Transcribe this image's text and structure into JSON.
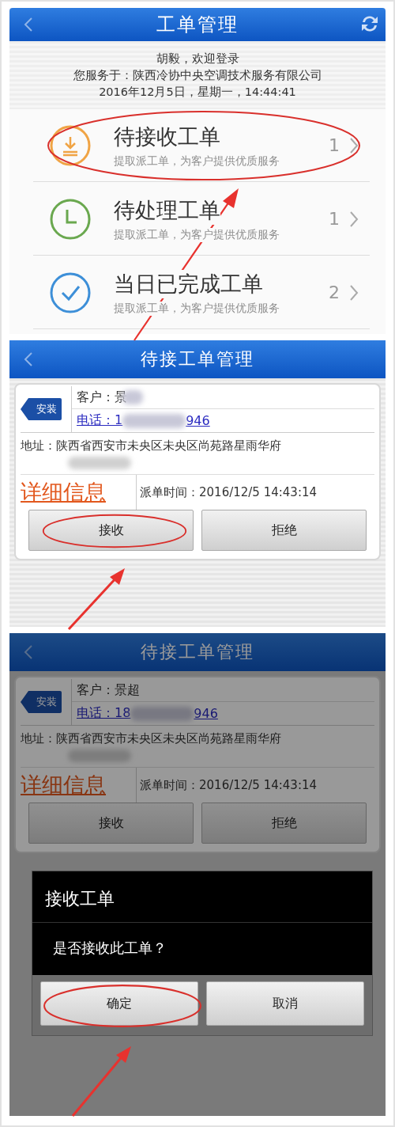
{
  "screens": [
    {
      "kind": "menu",
      "title": "工单管理",
      "greeting": "胡毅，欢迎登录",
      "company": "您服务于：陕西冷协中央空调技术服务有限公司",
      "datetime": "2016年12月5日，星期一，14:44:41",
      "items": [
        {
          "kind": "download",
          "color": "#f0a445",
          "title": "待接收工单",
          "subtitle": "提取派工单，为客户提供优质服务",
          "count": "1",
          "circled": true
        },
        {
          "kind": "clock",
          "color": "#6aa84f",
          "title": "待处理工单",
          "subtitle": "提取派工单，为客户提供优质服务",
          "count": "1",
          "circled": false
        },
        {
          "kind": "check",
          "color": "#3d8fd8",
          "title": "当日已完成工单",
          "subtitle": "提取派工单，为客户提供优质服务",
          "count": "2",
          "circled": false
        }
      ]
    },
    {
      "kind": "order",
      "title": "待接工单管理",
      "dimmed": false,
      "order": {
        "tag": "安装",
        "customer": "客户：景",
        "customer_redacted": true,
        "phone_prefix": "电话：1",
        "phone_suffix": "946",
        "address": "地址：陕西省西安市未央区未央区尚苑路星雨华府",
        "address_redacted": true,
        "details_link": "详细信息",
        "dispatch_time": "派单时间：2016/12/5 14:43:14"
      },
      "buttons": [
        {
          "label": "接收",
          "circled": true
        },
        {
          "label": "拒绝",
          "circled": false
        }
      ]
    },
    {
      "kind": "order",
      "title": "待接工单管理",
      "dimmed": true,
      "order": {
        "tag": "安装",
        "customer": "客户：景超",
        "customer_redacted": false,
        "phone_prefix": "电话：18",
        "phone_suffix": "946",
        "address": "地址：陕西省西安市未央区未央区尚苑路星雨华府",
        "address_redacted": true,
        "details_link": "详细信息",
        "dispatch_time": "派单时间：2016/12/5 14:43:14"
      },
      "buttons": [
        {
          "label": "接收",
          "circled": false
        },
        {
          "label": "拒绝",
          "circled": false
        }
      ],
      "dialog": {
        "title": "接收工单",
        "message": "是否接收此工单？",
        "buttons": [
          {
            "label": "确定",
            "circled": true
          },
          {
            "label": "取消",
            "circled": false
          }
        ]
      }
    }
  ]
}
